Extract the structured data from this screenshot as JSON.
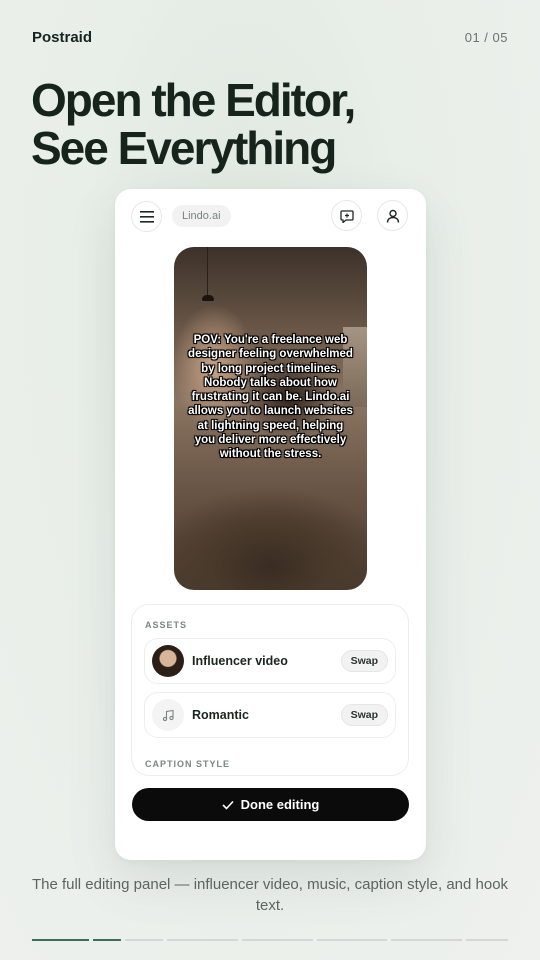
{
  "brand": "Postraid",
  "counter": "01 / 05",
  "headline": {
    "line1": "Open the Editor,",
    "line2": "See Everything"
  },
  "app": {
    "tag": "Lindo.ai",
    "icons": {
      "menu": "hamburger-menu-icon",
      "chat": "chat-icon",
      "user": "user-icon"
    },
    "video_caption": "POV: You're a freelance web designer feeling overwhelmed by long project timelines. Nobody talks about how frustrating it can be. Lindo.ai allows you to launch websites at lightning speed, helping you deliver more effectively without the stress.",
    "assets_label": "ASSETS",
    "assets": [
      {
        "name": "Influencer video",
        "action": "Swap",
        "icon": "avatar-thumbnail"
      },
      {
        "name": "Romantic",
        "action": "Swap",
        "icon": "music-note-icon"
      }
    ],
    "caption_style_label": "CAPTION STYLE",
    "done_button": "Done editing"
  },
  "footer_text": "The full editing panel — influencer video, music, caption style, and hook text.",
  "progress": {
    "total_slides": 5,
    "current_slide": 1
  }
}
